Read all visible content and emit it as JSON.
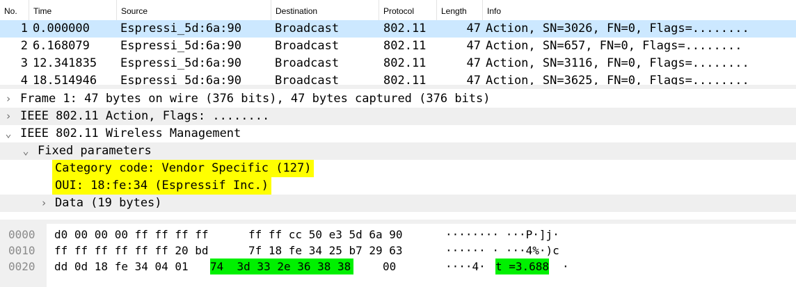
{
  "packet_list": {
    "columns": [
      "No.",
      "Time",
      "Source",
      "Destination",
      "Protocol",
      "Length",
      "Info"
    ],
    "rows": [
      {
        "no": "1",
        "time": "0.000000",
        "source": "Espressi_5d:6a:90",
        "destination": "Broadcast",
        "protocol": "802.11",
        "length": "47",
        "info": "Action, SN=3026, FN=0, Flags=........",
        "selected": true
      },
      {
        "no": "2",
        "time": "6.168079",
        "source": "Espressi_5d:6a:90",
        "destination": "Broadcast",
        "protocol": "802.11",
        "length": "47",
        "info": "Action, SN=657, FN=0, Flags=........",
        "selected": false
      },
      {
        "no": "3",
        "time": "12.341835",
        "source": "Espressi_5d:6a:90",
        "destination": "Broadcast",
        "protocol": "802.11",
        "length": "47",
        "info": "Action, SN=3116, FN=0, Flags=........",
        "selected": false
      },
      {
        "no": "4",
        "time": "18.514946",
        "source": "Espressi_5d:6a:90",
        "destination": "Broadcast",
        "protocol": "802.11",
        "length": "47",
        "info": "Action, SN=3625, FN=0, Flags=........",
        "selected": false
      }
    ]
  },
  "details": {
    "items": [
      {
        "text": "Frame 1: 47 bytes on wire (376 bits), 47 bytes captured (376 bits)",
        "expanded": false,
        "highlight": false
      },
      {
        "text": "IEEE 802.11 Action, Flags: ........",
        "expanded": false,
        "highlight": false
      },
      {
        "text": "IEEE 802.11 Wireless Management",
        "expanded": true,
        "highlight": false
      },
      {
        "text": "Fixed parameters",
        "expanded": true,
        "highlight": false
      },
      {
        "text": "Category code: Vendor Specific (127)",
        "expanded": null,
        "highlight": true
      },
      {
        "text": "OUI: 18:fe:34 (Espressif Inc.)",
        "expanded": null,
        "highlight": true
      },
      {
        "text": "Data (19 bytes)",
        "expanded": false,
        "highlight": false
      }
    ]
  },
  "bytes": {
    "rows": [
      {
        "offset": "0000",
        "hex_a": "d0 00 00 00 ff ff ff ff",
        "hex_b": "ff ff cc 50 e3 5d 6a 90",
        "ascii": "········ ···P·]j·"
      },
      {
        "offset": "0010",
        "hex_a": "ff ff ff ff ff ff 20 bd",
        "hex_b": "7f 18 fe 34 25 b7 29 63",
        "ascii": "······ · ···4%·)c"
      },
      {
        "offset": "0020",
        "hex_a": "dd 0d 18 fe 34 04 01",
        "hex_hl": "74  3d 33 2e 36 38 38",
        "hex_tail": "00",
        "ascii_a": "····4·",
        "ascii_hl": "t =3.688",
        "ascii_b": "·"
      }
    ]
  },
  "colors": {
    "selected_row": "#cce8ff",
    "field_highlight": "#ffff00",
    "byte_highlight": "#00f000",
    "stripe": "#efefef"
  }
}
